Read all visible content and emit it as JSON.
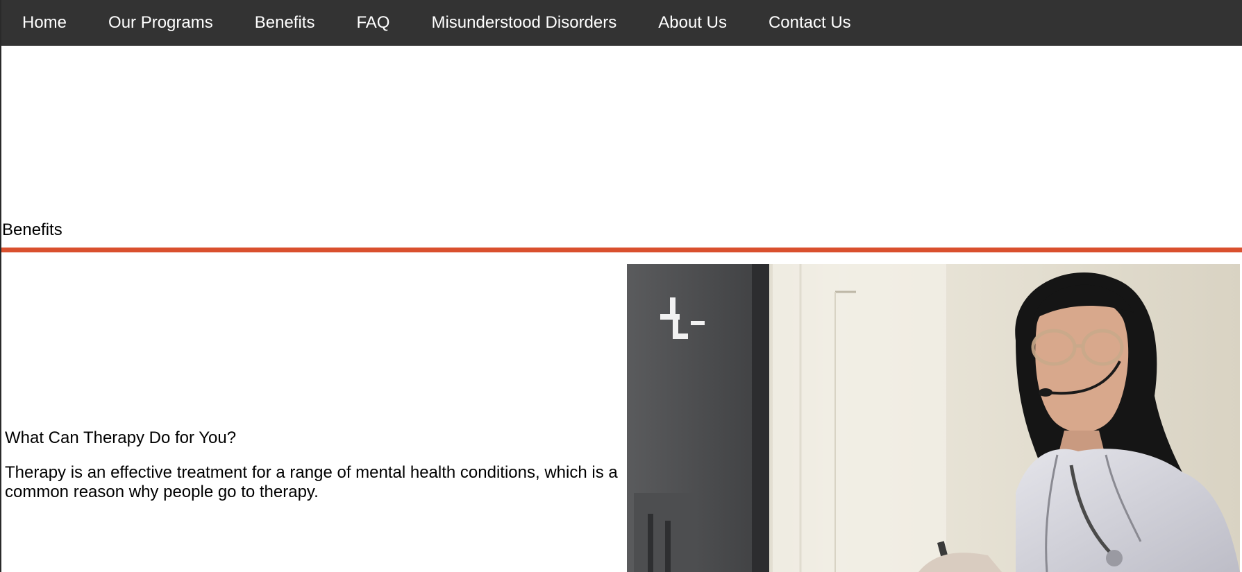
{
  "nav": {
    "items": [
      {
        "label": "Home"
      },
      {
        "label": "Our Programs"
      },
      {
        "label": "Benefits"
      },
      {
        "label": "FAQ"
      },
      {
        "label": "Misunderstood Disorders"
      },
      {
        "label": "About Us"
      },
      {
        "label": "Contact Us"
      }
    ]
  },
  "section": {
    "title": "Benefits"
  },
  "content": {
    "heading": "What Can Therapy Do for You?",
    "paragraph": "Therapy is an effective treatment for a range of mental health conditions, which is a common reason why people go to therapy."
  },
  "image": {
    "subject": "doctor-with-headset-photo"
  },
  "colors": {
    "nav_background": "#333333",
    "accent_divider": "#d9502e"
  }
}
